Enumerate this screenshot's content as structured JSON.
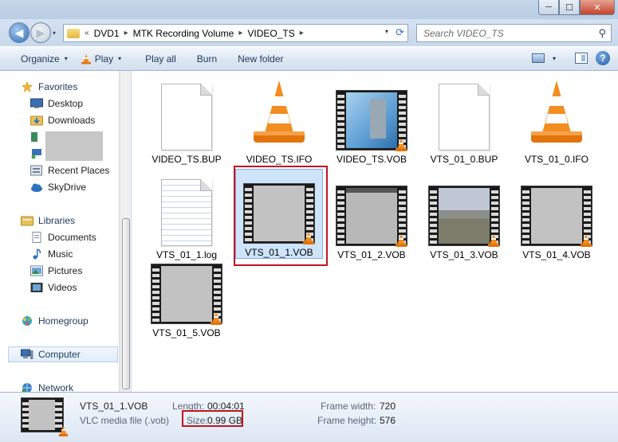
{
  "window": {
    "minimize": "─",
    "maximize": "☐",
    "close": "✕"
  },
  "nav": {
    "back_icon": "◀",
    "forward_icon": "▶",
    "dropdown_icon": "▾",
    "breadcrumb_prefix": "«",
    "breadcrumbs": [
      "DVD1",
      "MTK Recording Volume",
      "VIDEO_TS"
    ],
    "separator": "▸",
    "address_dropdown": "▾",
    "refresh_icon": "⟳",
    "search_placeholder": "Search VIDEO_TS",
    "search_icon": "⚲"
  },
  "toolbar": {
    "organize": "Organize",
    "play": "Play",
    "play_all": "Play all",
    "burn": "Burn",
    "new_folder": "New folder",
    "dropdown": "▾",
    "help": "?"
  },
  "sidebar": {
    "favorites": "Favorites",
    "desktop": "Desktop",
    "downloads": "Downloads",
    "recent_places": "Recent Places",
    "skydrive": "SkyDrive",
    "libraries": "Libraries",
    "documents": "Documents",
    "music": "Music",
    "pictures": "Pictures",
    "videos": "Videos",
    "homegroup": "Homegroup",
    "computer": "Computer",
    "network": "Network"
  },
  "files": [
    {
      "name": "VIDEO_TS.BUP",
      "kind": "doc"
    },
    {
      "name": "VIDEO_TS.IFO",
      "kind": "vlc"
    },
    {
      "name": "VIDEO_TS.VOB",
      "kind": "video-blue"
    },
    {
      "name": "VTS_01_0.BUP",
      "kind": "doc"
    },
    {
      "name": "VTS_01_0.IFO",
      "kind": "vlc"
    },
    {
      "name": "VTS_01_1.log",
      "kind": "text"
    },
    {
      "name": "VTS_01_1.VOB",
      "kind": "video",
      "selected": true
    },
    {
      "name": "VTS_01_2.VOB",
      "kind": "video-dark"
    },
    {
      "name": "VTS_01_3.VOB",
      "kind": "video-land"
    },
    {
      "name": "VTS_01_4.VOB",
      "kind": "video"
    },
    {
      "name": "VTS_01_5.VOB",
      "kind": "video"
    }
  ],
  "details": {
    "name": "VTS_01_1.VOB",
    "type": "VLC media file (.vob)",
    "length_label": "Length:",
    "length": "00:04:01",
    "size_label": "Size:",
    "size": "0.99 GB",
    "frame_width_label": "Frame width:",
    "frame_width": "720",
    "frame_height_label": "Frame height:",
    "frame_height": "576"
  },
  "colors": {
    "highlight_box": "#c0141c",
    "selection": "#cde4fb"
  }
}
